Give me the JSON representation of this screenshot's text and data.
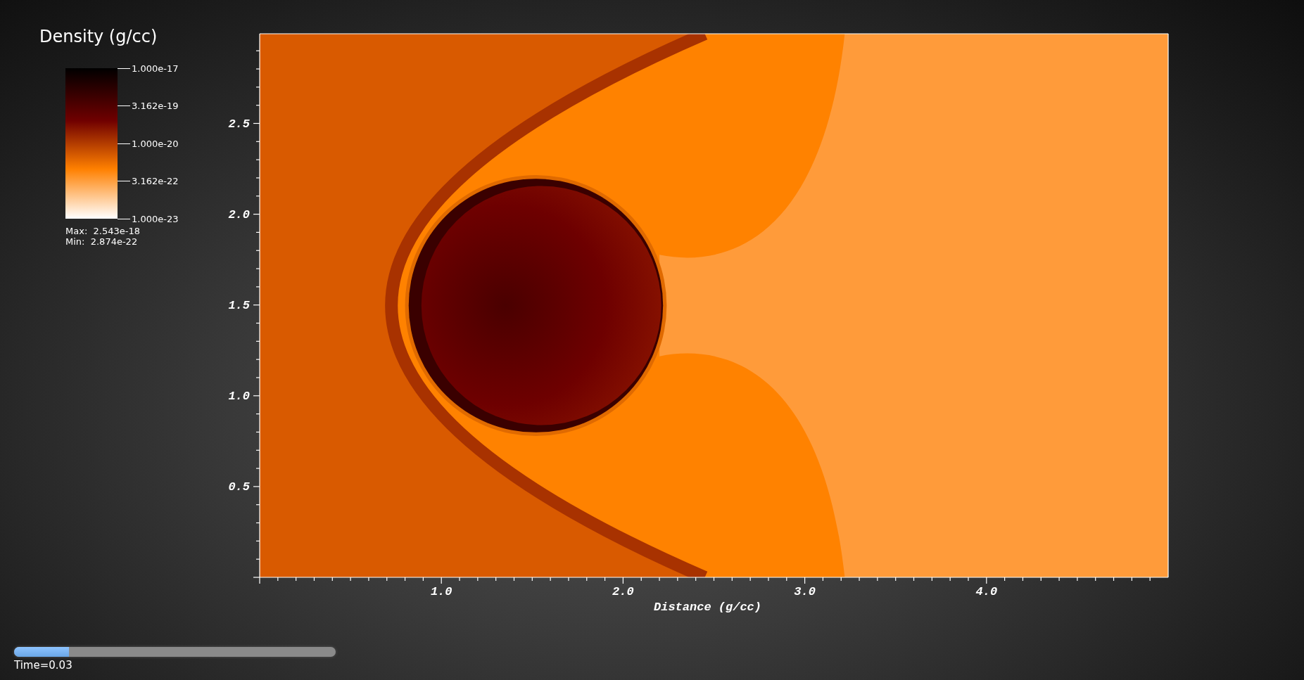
{
  "legend": {
    "title": "Density (g/cc)",
    "ticks": [
      "1.000e-17",
      "3.162e-19",
      "1.000e-20",
      "3.162e-22",
      "1.000e-23"
    ],
    "max": "Max:  2.543e-18",
    "min": "Min:  2.874e-22"
  },
  "plot": {
    "y_ticks": [
      "2.5",
      "2.0",
      "1.5",
      "1.0",
      "0.5"
    ],
    "x_ticks": [
      "1.0",
      "2.0",
      "3.0",
      "4.0"
    ],
    "x_axis_title": "Distance (g/cc)"
  },
  "time_slider": {
    "level": 0.17,
    "label": "Time=0.03"
  }
}
